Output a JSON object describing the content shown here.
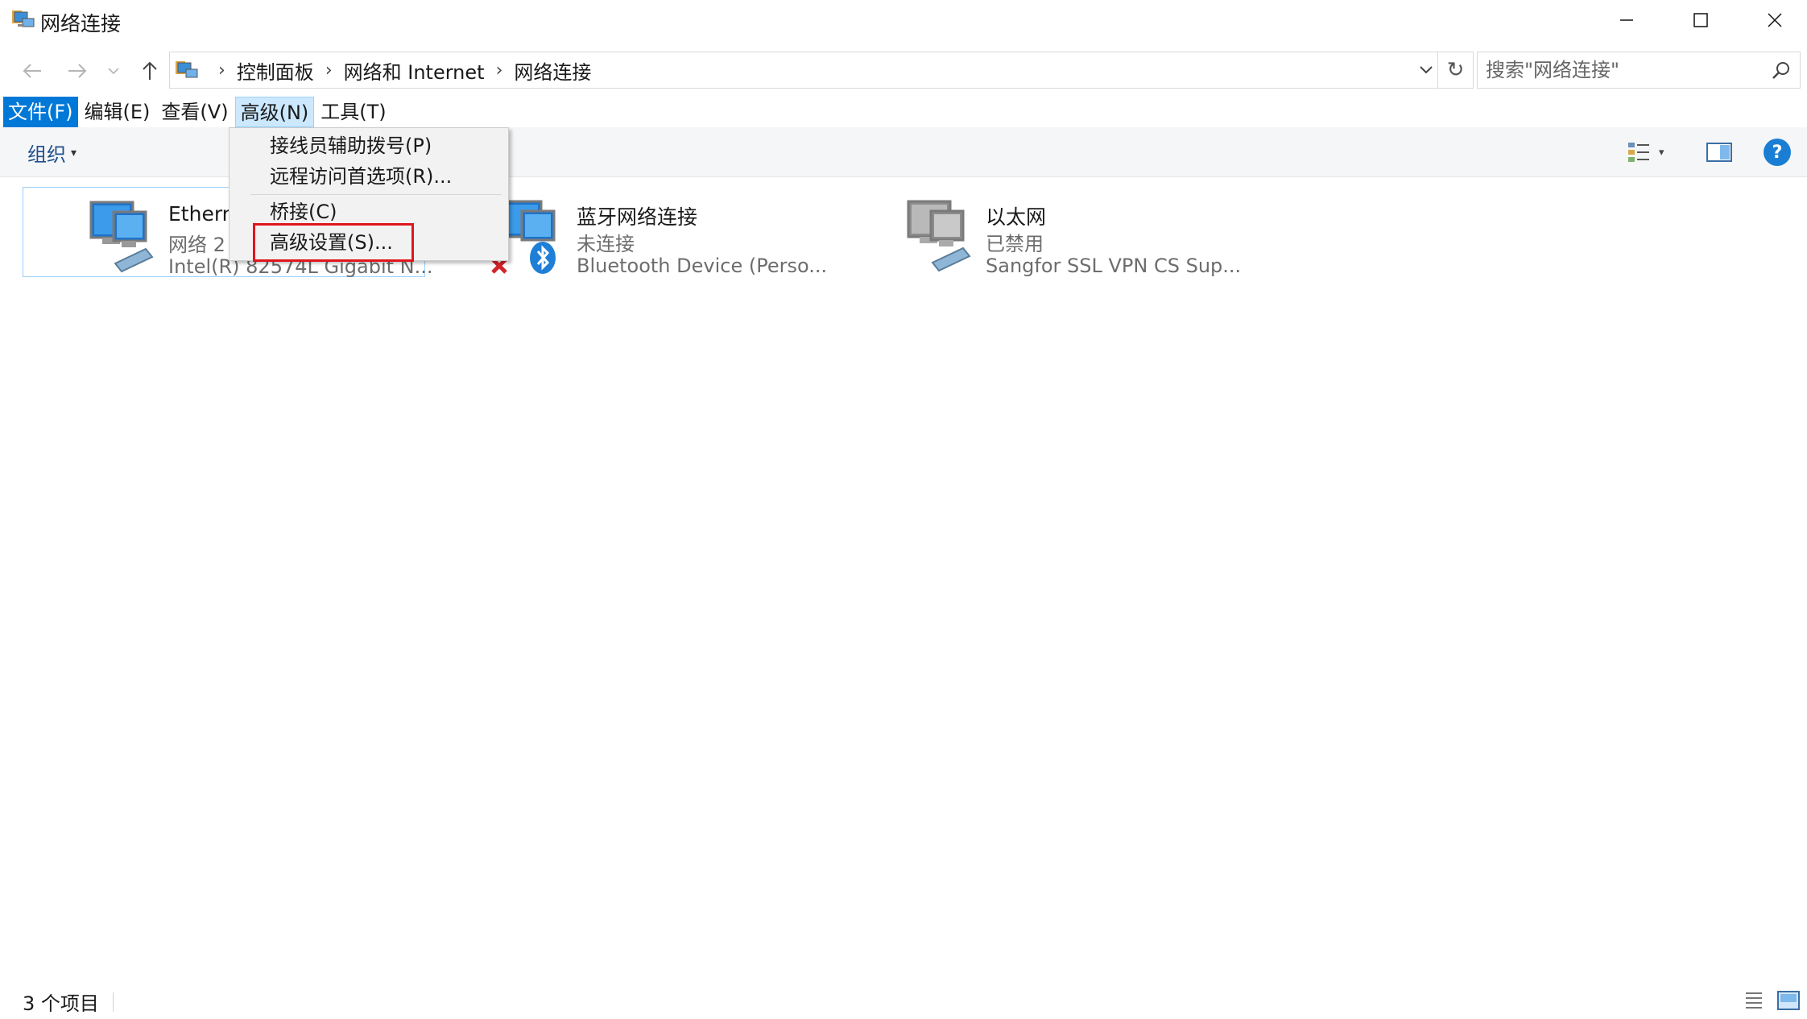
{
  "window": {
    "title": "网络连接",
    "icon": "network-connections-icon"
  },
  "address": {
    "crumbs": [
      "控制面板",
      "网络和 Internet",
      "网络连接"
    ],
    "search_placeholder": "搜索\"网络连接\""
  },
  "menubar": {
    "file": "文件(F)",
    "edit": "编辑(E)",
    "view": "查看(V)",
    "advanced": "高级(N)",
    "tools": "工具(T)"
  },
  "toolbar": {
    "organize": "组织",
    "help": "?"
  },
  "advanced_menu": {
    "items": [
      "接线员辅助拨号(P)",
      "远程访问首选项(R)...",
      "桥接(C)",
      "高级设置(S)..."
    ]
  },
  "connections": [
    {
      "name": "Ethern",
      "status": "网络 2",
      "device": "Intel(R) 82574L Gigabit N..."
    },
    {
      "name": "蓝牙网络连接",
      "status": "未连接",
      "device": "Bluetooth Device (Perso..."
    },
    {
      "name": "以太网",
      "status": "已禁用",
      "device": "Sangfor SSL VPN CS Sup..."
    }
  ],
  "statusbar": {
    "count": "3 个项目"
  },
  "colors": {
    "accent": "#0078d7",
    "highlight_box": "#e0161e",
    "help": "#1a7fd4"
  }
}
